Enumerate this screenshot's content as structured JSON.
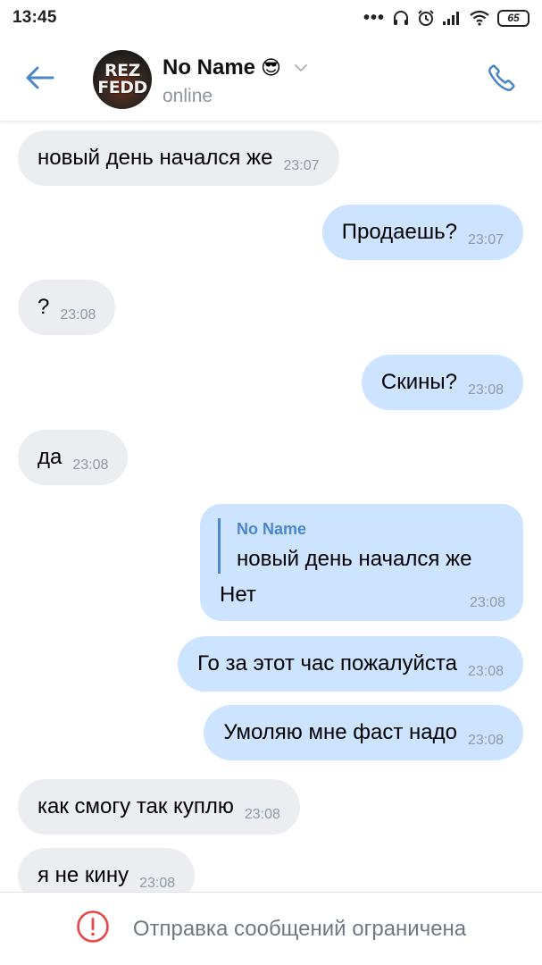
{
  "status_bar": {
    "time": "13:45",
    "battery": "65",
    "icons": [
      "more-dots-icon",
      "headphones-icon",
      "alarm-icon",
      "signal-icon",
      "wifi-icon",
      "battery-icon"
    ]
  },
  "header": {
    "contact_name": "No Name",
    "contact_emoji": "😎",
    "status": "online",
    "avatar_text": "REZ\nFEDD",
    "icons": {
      "back": "arrow-left-icon",
      "call": "phone-icon",
      "expand": "chevron-down-icon"
    },
    "accent_color": "#4a86c9"
  },
  "messages": [
    {
      "dir": "in",
      "text": "новый день начался же",
      "time": "23:07"
    },
    {
      "dir": "out",
      "text": "Продаешь?",
      "time": "23:07"
    },
    {
      "dir": "in",
      "text": "?",
      "time": "23:08"
    },
    {
      "dir": "out",
      "text": "Скины?",
      "time": "23:08"
    },
    {
      "dir": "in",
      "text": "да",
      "time": "23:08"
    },
    {
      "dir": "out",
      "reply_to": {
        "name": "No Name",
        "text": "новый день начался же"
      },
      "text": "Нет",
      "time": "23:08"
    },
    {
      "dir": "out",
      "text": "Го за этот час пожалуйста",
      "time": "23:08"
    },
    {
      "dir": "out",
      "text": "Умоляю мне фаст надо",
      "time": "23:08"
    },
    {
      "dir": "in",
      "text": "как смогу так куплю",
      "time": "23:08"
    },
    {
      "dir": "in",
      "text": "я не кину",
      "time": "23:08"
    }
  ],
  "footer": {
    "text": "Отправка сообщений ограничена",
    "icon": "warning-circle-icon",
    "icon_color": "#e64646"
  },
  "colors": {
    "incoming_bubble": "#ebedf0",
    "outgoing_bubble": "#cce4ff",
    "time_text": "#8e99a5"
  }
}
